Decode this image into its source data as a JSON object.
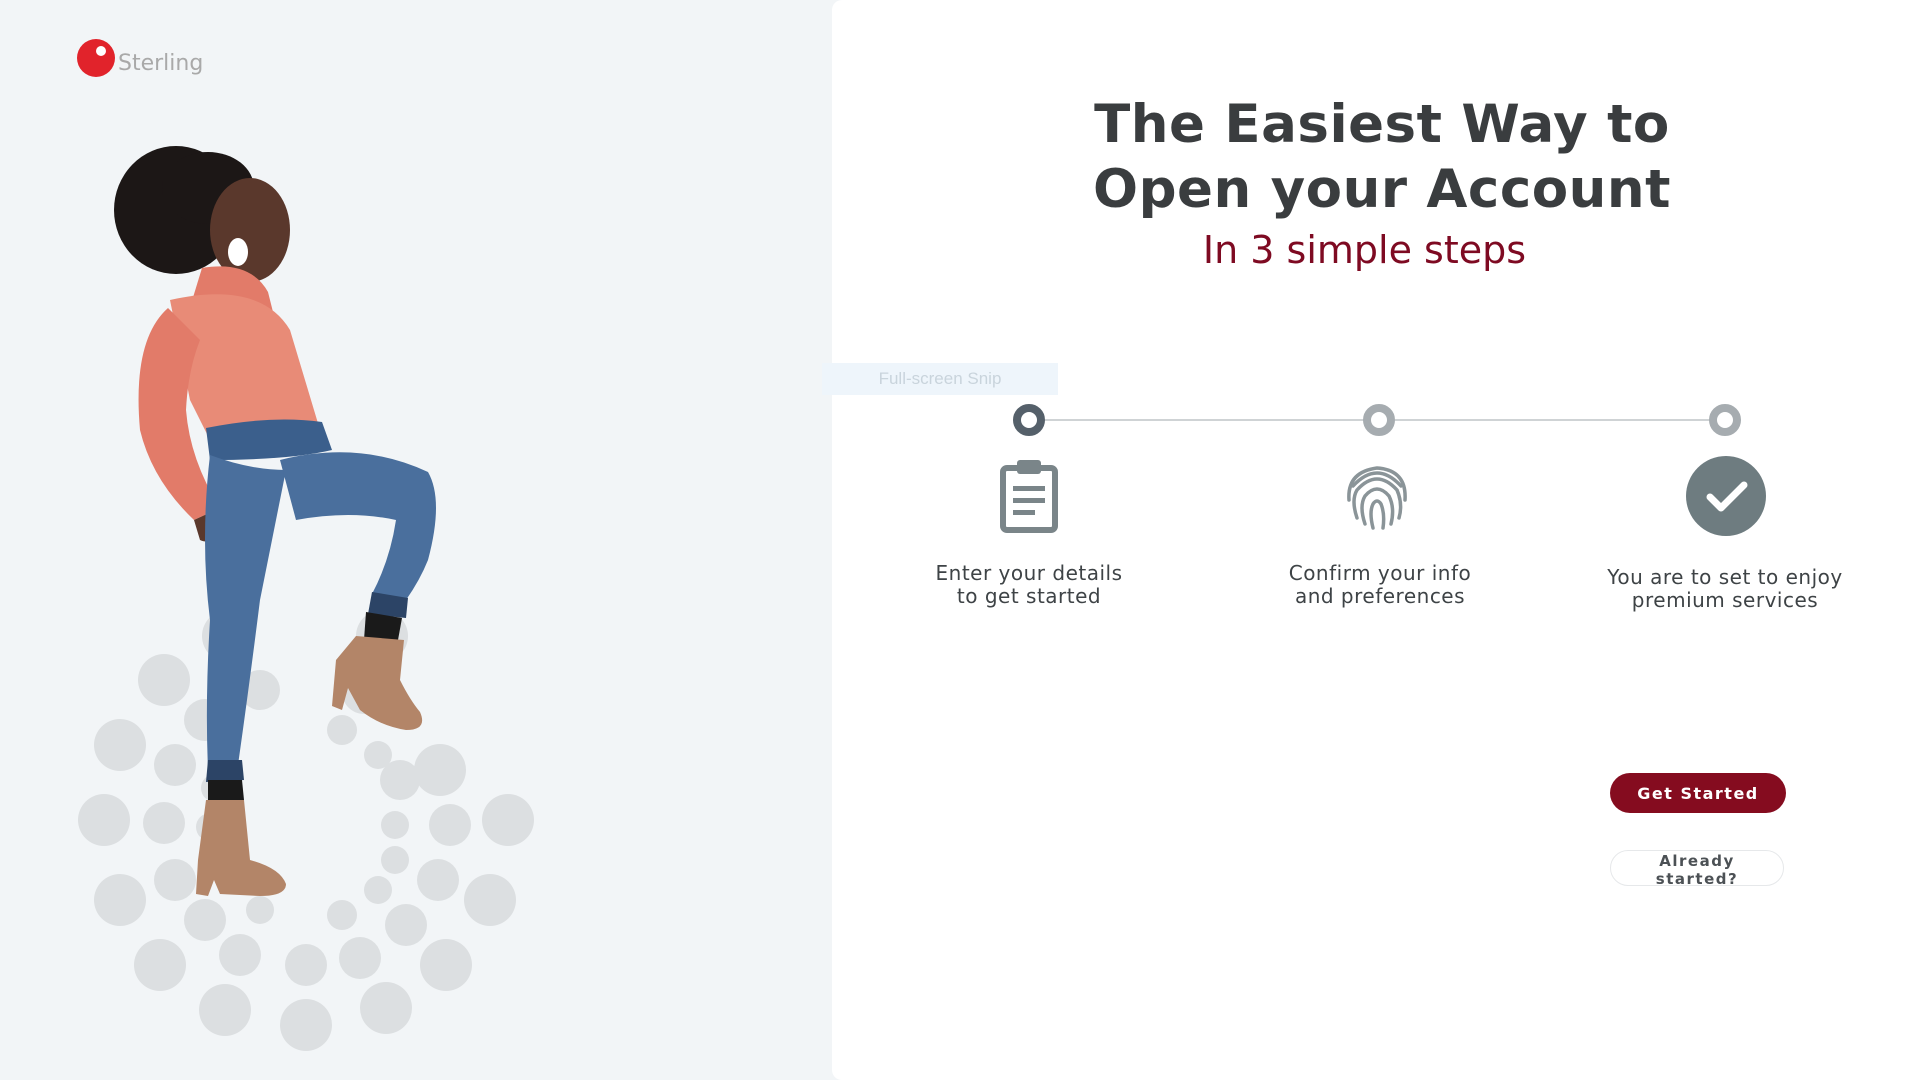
{
  "brand": {
    "name": "Sterling",
    "logo_color": "#e1232b"
  },
  "hero": {
    "title_line1": "The Easiest Way to",
    "title_line2": "Open your Account",
    "subtitle": "In 3 simple steps",
    "subtitle_color": "#7e0a22"
  },
  "overlay": {
    "snip_label": "Full-screen Snip"
  },
  "steps": [
    {
      "icon": "clipboard-icon",
      "line1": "Enter your details",
      "line2": "to get started",
      "state": "active"
    },
    {
      "icon": "fingerprint-icon",
      "line1": "Confirm your info",
      "line2": "and preferences",
      "state": "inactive"
    },
    {
      "icon": "check-circle-icon",
      "line1": "You are to set to enjoy",
      "line2": "premium services",
      "state": "inactive"
    }
  ],
  "actions": {
    "get_started": "Get Started",
    "already_started": "Already started?",
    "primary_color": "#850c1f"
  }
}
